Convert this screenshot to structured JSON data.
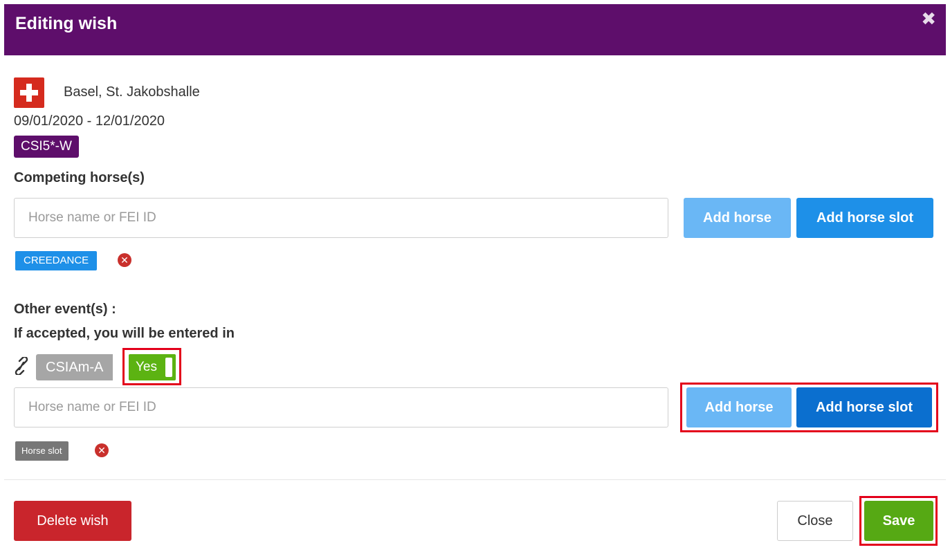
{
  "modal": {
    "title": "Editing wish",
    "close_symbol": "✖"
  },
  "event": {
    "flag_icon": "swiss-flag-icon",
    "venue": "Basel, St. Jakobshalle",
    "dates": "09/01/2020 - 12/01/2020",
    "category": "CSI5*-W"
  },
  "competing": {
    "label": "Competing horse(s)",
    "input_placeholder": "Horse name or FEI ID",
    "add_horse_label": "Add horse",
    "add_horse_slot_label": "Add horse slot",
    "horses": [
      "CREEDANCE"
    ]
  },
  "other_events": {
    "label_line1": "Other event(s) :",
    "label_line2": "If accepted, you will be entered in",
    "link_icon": "link-icon",
    "event_name": "CSIAm-A",
    "toggle_label": "Yes",
    "input_placeholder": "Horse name or FEI ID",
    "add_horse_label": "Add horse",
    "add_horse_slot_label": "Add horse slot",
    "slots": [
      "Horse slot"
    ]
  },
  "footer": {
    "delete_label": "Delete wish",
    "close_label": "Close",
    "save_label": "Save"
  },
  "colors": {
    "header": "#5e0e6b",
    "primary_blue": "#1e90e8",
    "light_blue": "#6ab7f5",
    "danger": "#c9252c",
    "success": "#56a914",
    "highlight": "#e3001b"
  }
}
